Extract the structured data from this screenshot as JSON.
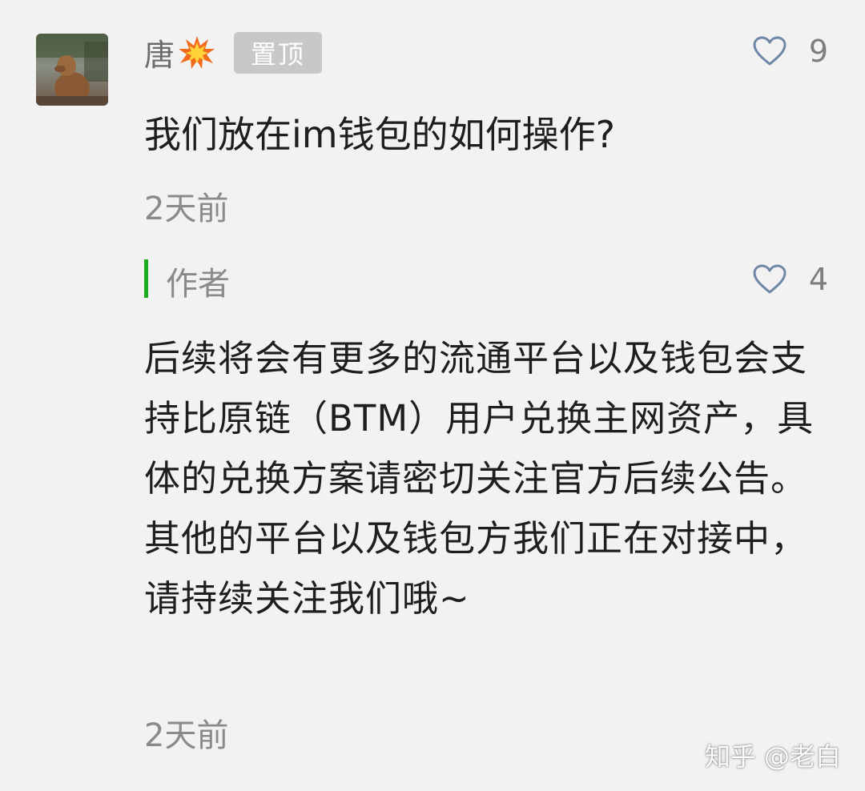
{
  "comment": {
    "username": "唐",
    "username_emoji_icon": "collision-burst-icon",
    "pin_badge": "置顶",
    "likes": "9",
    "text": "我们放在im钱包的如何操作?",
    "time": "2天前"
  },
  "reply": {
    "author_label": "作者",
    "likes": "4",
    "text": "后续将会有更多的流通平台以及钱包会支持比原链（BTM）用户兑换主网资产，具体的兑换方案请密切关注官方后续公告。其他的平台以及钱包方我们正在对接中，请持续关注我们哦~",
    "time": "2天前"
  },
  "watermark": "知乎 @老白",
  "colors": {
    "background": "#f2f2f2",
    "author_accent": "#1aad19",
    "like_icon": "#6f87a6",
    "pin_badge_bg": "#c8c8c8"
  }
}
